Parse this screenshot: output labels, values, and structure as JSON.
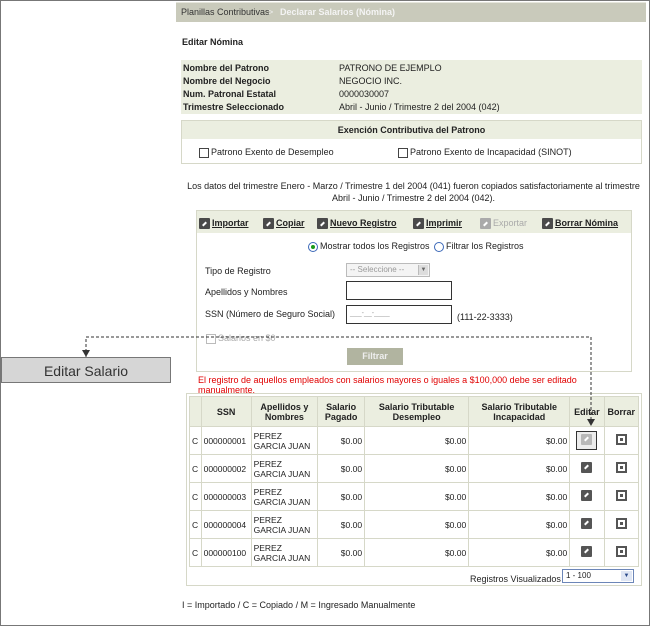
{
  "breadcrumb": {
    "parent": "Planillas Contributivas",
    "separator": ">",
    "current": "Declarar Salarios (Nómina)"
  },
  "page_title": "Editar Nómina",
  "info": [
    {
      "label": "Nombre del Patrono",
      "value": "PATRONO DE EJEMPLO"
    },
    {
      "label": "Nombre del Negocio",
      "value": "NEGOCIO INC."
    },
    {
      "label": "Num. Patronal Estatal",
      "value": "0000030007"
    },
    {
      "label": "Trimestre Seleccionado",
      "value": "Abril - Junio / Trimestre 2 del 2004 (042)"
    }
  ],
  "exemption": {
    "header": "Exención Contributiva del Patrono",
    "opt1": "Patrono Exento de Desempleo",
    "opt2": "Patrono Exento de Incapacidad (SINOT)"
  },
  "copy_message_line1": "Los datos del trimestre Enero - Marzo / Trimestre 1 del 2004 (041) fueron copiados satisfactoriamente al trimestre",
  "copy_message_line2": "Abril - Junio / Trimestre 2 del 2004 (042).",
  "toolbar": {
    "importar": "Importar",
    "copiar": "Copiar",
    "nuevo": "Nuevo Registro",
    "imprimir": "Imprimir",
    "exportar": "Exportar",
    "borrar": "Borrar Nómina"
  },
  "filter": {
    "radio_all": "Mostrar todos los Registros",
    "radio_filter": "Filtrar los Registros",
    "tipo_label": "Tipo de Registro",
    "tipo_value": "-- Seleccione --",
    "nombre_label": "Apellidos y Nombres",
    "ssn_label": "SSN (Número de Seguro Social)",
    "ssn_placeholder": "___-__-____",
    "ssn_hint": "(111-22-3333)",
    "salarios_cero": "Salarios en $0",
    "button": "Filtrar"
  },
  "warning": "El registro de aquellos empleados con salarios mayores o iguales a $100,000 debe ser editado manualmente.",
  "table": {
    "headers": {
      "ssn": "SSN",
      "nombres": "Apellidos y Nombres",
      "pagado": "Salario Pagado",
      "desempleo": "Salario Tributable Desempleo",
      "incapacidad": "Salario Tributable Incapacidad",
      "editar": "Editar",
      "borrar": "Borrar"
    },
    "rows": [
      {
        "tipo": "C",
        "ssn": "000000001",
        "nombre": "PEREZ GARCIA JUAN",
        "pagado": "$0.00",
        "desempleo": "$0.00",
        "incapacidad": "$0.00"
      },
      {
        "tipo": "C",
        "ssn": "000000002",
        "nombre": "PEREZ GARCIA JUAN",
        "pagado": "$0.00",
        "desempleo": "$0.00",
        "incapacidad": "$0.00"
      },
      {
        "tipo": "C",
        "ssn": "000000003",
        "nombre": "PEREZ GARCIA JUAN",
        "pagado": "$0.00",
        "desempleo": "$0.00",
        "incapacidad": "$0.00"
      },
      {
        "tipo": "C",
        "ssn": "000000004",
        "nombre": "PEREZ GARCIA JUAN",
        "pagado": "$0.00",
        "desempleo": "$0.00",
        "incapacidad": "$0.00"
      },
      {
        "tipo": "C",
        "ssn": "000000100",
        "nombre": "PEREZ GARCIA JUAN",
        "pagado": "$0.00",
        "desempleo": "$0.00",
        "incapacidad": "$0.00"
      }
    ]
  },
  "pager": {
    "label": "Registros Visualizados",
    "value": "1 - 100"
  },
  "legend": "I = Importado / C = Copiado / M = Ingresado Manualmente",
  "callout": "Editar Salario"
}
